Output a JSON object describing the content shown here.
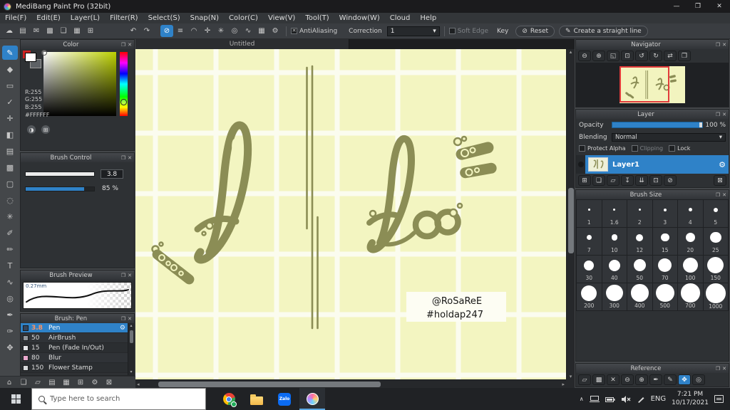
{
  "titlebar": {
    "title": "MediBang Paint Pro (32bit)",
    "min": "—",
    "max": "❐",
    "close": "✕"
  },
  "menubar": {
    "items": [
      "File(F)",
      "Edit(E)",
      "Layer(L)",
      "Filter(R)",
      "Select(S)",
      "Snap(N)",
      "Color(C)",
      "View(V)",
      "Tool(T)",
      "Window(W)",
      "Cloud",
      "Help"
    ]
  },
  "icons": {
    "float": "❐",
    "close": "✕",
    "dropdown": "▾",
    "gear": "⚙",
    "ban": "⊘",
    "pencil": "✎",
    "wheel": "◑",
    "grid2": "⊞",
    "scroll_up": "▴",
    "scroll_down": "▾",
    "scroll_left": "◂",
    "scroll_right": "▸"
  },
  "toolbar": {
    "file_icons": [
      {
        "name": "cloud-icon",
        "glyph": "☁"
      },
      {
        "name": "save-icon",
        "glyph": "▤"
      },
      {
        "name": "chat-icon",
        "glyph": "✉"
      },
      {
        "name": "image-icon",
        "glyph": "▩"
      },
      {
        "name": "document-icon",
        "glyph": "❏"
      },
      {
        "name": "grid-icon",
        "glyph": "▦"
      },
      {
        "name": "table-icon",
        "glyph": "⊞"
      }
    ],
    "undo_icon": "↶",
    "redo_icon": "↷",
    "snap_icons": [
      {
        "name": "snap-off-icon",
        "glyph": "⊘",
        "selected": true
      },
      {
        "name": "snap-parallel-icon",
        "glyph": "≡"
      },
      {
        "name": "snap-curve-icon",
        "glyph": "◠"
      },
      {
        "name": "snap-cross-icon",
        "glyph": "✛"
      },
      {
        "name": "snap-radial-icon",
        "glyph": "✳"
      },
      {
        "name": "snap-circle-icon",
        "glyph": "◎"
      },
      {
        "name": "snap-wave-icon",
        "glyph": "∿"
      },
      {
        "name": "snap-grid-icon",
        "glyph": "▦"
      },
      {
        "name": "snap-settings-icon",
        "glyph": "⚙"
      }
    ],
    "antialiasing_label": "AntiAliasing",
    "correction_label": "Correction",
    "correction_value": "1",
    "soft_edge_label": "Soft Edge",
    "key_label": "Key",
    "reset_label": "Reset",
    "straight_line_label": "Create a straight line"
  },
  "tools": [
    {
      "name": "brush-tool",
      "glyph": "✎",
      "selected": true
    },
    {
      "name": "eraser-tool",
      "glyph": "◆"
    },
    {
      "name": "finger-tool",
      "glyph": "▭"
    },
    {
      "name": "filter-tool",
      "glyph": "✓"
    },
    {
      "name": "move-tool",
      "glyph": "✛"
    },
    {
      "name": "fill-tool",
      "glyph": "◧"
    },
    {
      "name": "gradient-tool",
      "glyph": "▤"
    },
    {
      "name": "bucket-tool",
      "glyph": "▩"
    },
    {
      "name": "select-tool",
      "glyph": "▢"
    },
    {
      "name": "lasso-tool",
      "glyph": "◌"
    },
    {
      "name": "magic-wand-tool",
      "glyph": "✳"
    },
    {
      "name": "select-pen-tool",
      "glyph": "✐"
    },
    {
      "name": "select-eraser-tool",
      "glyph": "✏"
    },
    {
      "name": "text-tool",
      "glyph": "T"
    },
    {
      "name": "curve-tool",
      "glyph": "∿"
    },
    {
      "name": "divide-tool",
      "glyph": "◎"
    },
    {
      "name": "eyedropper-tool",
      "glyph": "✒"
    },
    {
      "name": "pen-tool",
      "glyph": "✑"
    },
    {
      "name": "hand-tool",
      "glyph": "✥"
    }
  ],
  "color_panel": {
    "title": "Color",
    "r": "R:255",
    "g": "G:255",
    "b": "B:255",
    "hex": "#FFFFFF"
  },
  "brush_control": {
    "title": "Brush Control",
    "size_value": "3.8",
    "opacity_value": "85 %"
  },
  "brush_preview": {
    "title": "Brush Preview",
    "size_label": "0.27mm"
  },
  "brush_list": {
    "title": "Brush: Pen",
    "items": [
      {
        "size": "3.8",
        "name": "Pen",
        "selected": true,
        "chip": "#35455c"
      },
      {
        "size": "50",
        "name": "AirBrush",
        "chip": "#8f9498"
      },
      {
        "size": "15",
        "name": "Pen (Fade In/Out)",
        "chip": "#e4e6e8"
      },
      {
        "size": "80",
        "name": "Blur",
        "chip": "#e9a8cd"
      },
      {
        "size": "150",
        "name": "Flower Stamp",
        "chip": "#d7d9db"
      }
    ]
  },
  "left_footer_icons": [
    {
      "name": "home-icon",
      "glyph": "⌂"
    },
    {
      "name": "new-document-icon",
      "glyph": "❏"
    },
    {
      "name": "open-folder-icon",
      "glyph": "▱"
    },
    {
      "name": "save-icon",
      "glyph": "▤"
    },
    {
      "name": "material-icon",
      "glyph": "▦"
    },
    {
      "name": "snap-icon",
      "glyph": "⊞"
    },
    {
      "name": "settings-icon",
      "glyph": "⚙"
    },
    {
      "name": "trash-icon",
      "glyph": "⊠"
    }
  ],
  "canvas": {
    "tab": "Untitled",
    "credit_line1": "@RoSaReE",
    "credit_line2": "#holdap247"
  },
  "navigator": {
    "title": "Navigator",
    "icons": [
      {
        "name": "zoom-out-icon",
        "glyph": "⊖"
      },
      {
        "name": "zoom-in-icon",
        "glyph": "⊕"
      },
      {
        "name": "fit-window-icon",
        "glyph": "◱"
      },
      {
        "name": "actual-size-icon",
        "glyph": "⊡"
      },
      {
        "name": "rotate-left-icon",
        "glyph": "↺"
      },
      {
        "name": "rotate-right-icon",
        "glyph": "↻"
      },
      {
        "name": "flip-icon",
        "glyph": "⇄"
      },
      {
        "name": "reset-view-icon",
        "glyph": "❐"
      }
    ]
  },
  "layer": {
    "title": "Layer",
    "opacity_label": "Opacity",
    "opacity_value": "100 %",
    "blending_label": "Blending",
    "blending_value": "Normal",
    "protect_alpha_label": "Protect Alpha",
    "clipping_label": "Clipping",
    "lock_label": "Lock",
    "layer_name": "Layer1",
    "icons": [
      {
        "name": "new-layer-icon",
        "glyph": "⊞"
      },
      {
        "name": "duplicate-layer-icon",
        "glyph": "❏"
      },
      {
        "name": "new-folder-icon",
        "glyph": "▱"
      },
      {
        "name": "transfer-layer-icon",
        "glyph": "↧"
      },
      {
        "name": "merge-layer-icon",
        "glyph": "⇊"
      },
      {
        "name": "layer-settings-icon",
        "glyph": "⊡"
      },
      {
        "name": "clear-layer-icon",
        "glyph": "⊘"
      },
      {
        "name": "delete-layer-icon",
        "glyph": "⊠"
      }
    ]
  },
  "brush_size": {
    "title": "Brush Size",
    "sizes": [
      "1",
      "1.6",
      "2",
      "3",
      "4",
      "5",
      "7",
      "10",
      "12",
      "15",
      "20",
      "25",
      "30",
      "40",
      "50",
      "70",
      "100",
      "150",
      "200",
      "300",
      "400",
      "500",
      "700",
      "1000"
    ]
  },
  "reference": {
    "title": "Reference",
    "icons": [
      {
        "name": "open-reference-icon",
        "glyph": "▱"
      },
      {
        "name": "image-reference-icon",
        "glyph": "▩"
      },
      {
        "name": "close-reference-icon",
        "glyph": "✕"
      },
      {
        "name": "ref-zoom-out-icon",
        "glyph": "⊖"
      },
      {
        "name": "ref-zoom-in-icon",
        "glyph": "⊕"
      },
      {
        "name": "ref-eyedropper-icon",
        "glyph": "✒"
      },
      {
        "name": "ref-pen-icon",
        "glyph": "✎"
      },
      {
        "name": "ref-hand-icon",
        "glyph": "✥",
        "active": true
      },
      {
        "name": "ref-target-icon",
        "glyph": "◎"
      }
    ]
  },
  "taskbar": {
    "search_placeholder": "Type here to search",
    "zalo_label": "Zalo",
    "chevron": "∧",
    "lang": "ENG",
    "time": "7:21 PM",
    "date": "10/17/2021"
  },
  "colors": {
    "accent_blue": "#2f82c8",
    "canvas_bg": "#f3f5c1",
    "grid_white": "#fbfcef",
    "ink_olive": "#8b8d55",
    "navigator_view_red": "#e23b3b",
    "current_color": "#FFFFFF"
  }
}
